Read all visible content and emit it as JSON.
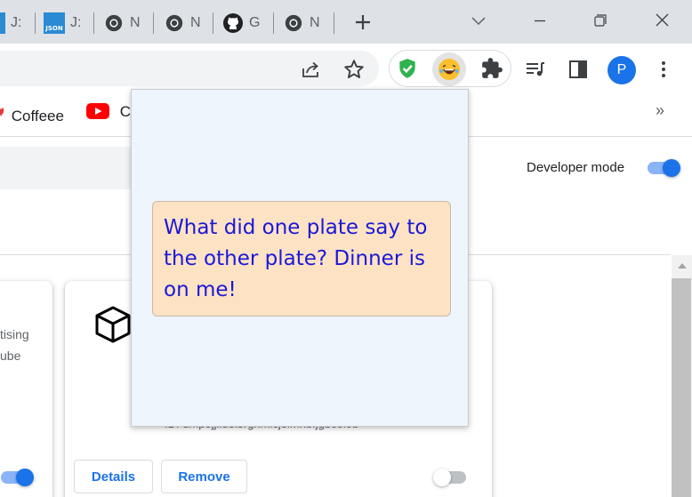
{
  "tabs": [
    {
      "favicon": "json-icon",
      "title": "J:"
    },
    {
      "favicon": "json-icon",
      "title": "J:"
    },
    {
      "favicon": "chrome-icon",
      "title": "N"
    },
    {
      "favicon": "chrome-icon",
      "title": "N"
    },
    {
      "favicon": "github-icon",
      "title": "G"
    },
    {
      "favicon": "chrome-icon",
      "title": "N"
    }
  ],
  "json_favicon_text": "JSON",
  "toolbar": {
    "avatar_letter": "P"
  },
  "bookmarks": [
    {
      "icon": "heart-icon",
      "label": "Coffeee"
    },
    {
      "icon": "youtube-icon",
      "label": "Co"
    }
  ],
  "bookmarks_more": "»",
  "extensions_page": {
    "developer_mode_label": "Developer mode",
    "developer_mode_on": true,
    "left_card_fragments": [
      "tising",
      "ube"
    ],
    "card": {
      "id_text": "ID: dmpojjlldelbrghmicjelmnbfjgbcolob",
      "details_label": "Details",
      "remove_label": "Remove",
      "enabled": false
    }
  },
  "popup": {
    "joke": "What did one plate say to the other plate? Dinner is on me!",
    "background": "#eef5fc",
    "box_background": "#fde3c4",
    "text_color": "#1c18d8"
  },
  "colors": {
    "accent": "#1a73e8",
    "tabstrip": "#dee1e6"
  }
}
